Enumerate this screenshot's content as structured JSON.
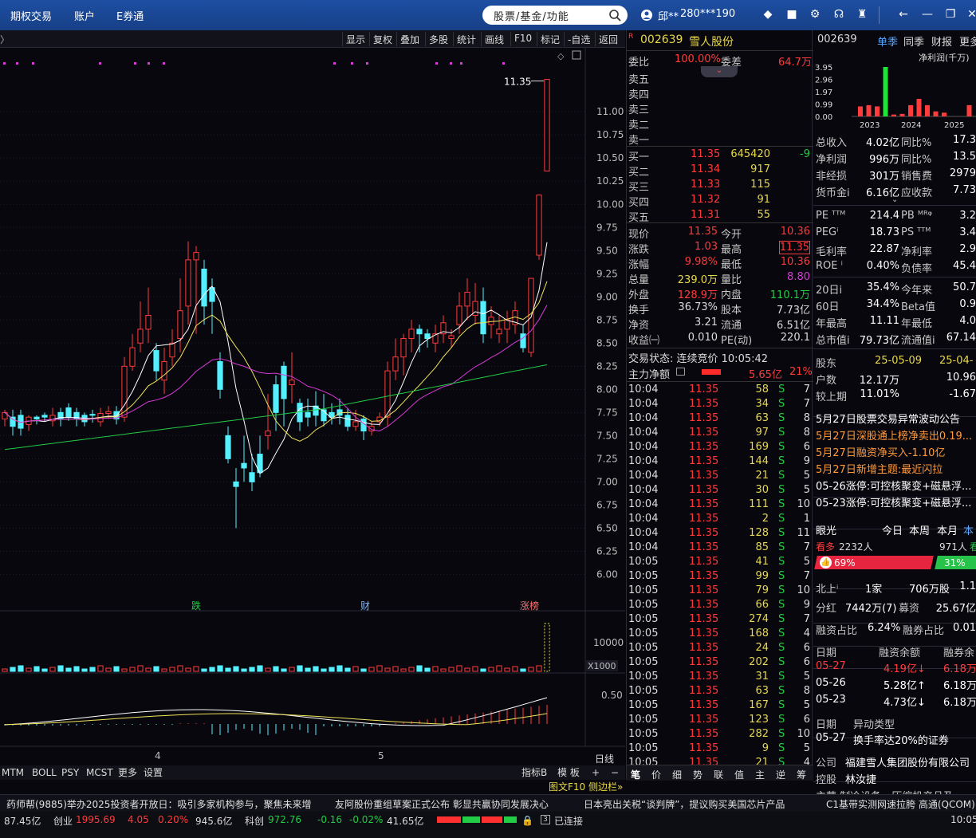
{
  "topbar": {
    "menus": [
      "期权交易",
      "账户",
      "E券通"
    ],
    "search_placeholder": "股票/基金/功能",
    "user_name": "邱**",
    "user_phone": "280***190"
  },
  "chart_toolbar": {
    "buttons": [
      "显示",
      "复权",
      "叠加",
      "多股",
      "统计",
      "画线",
      "F10",
      "标记",
      "-自选",
      "返回"
    ]
  },
  "chart": {
    "last_price_label": "11.35",
    "y_ticks": [
      "11.00",
      "10.75",
      "10.50",
      "10.25",
      "10.00",
      "9.75",
      "9.50",
      "9.25",
      "9.00",
      "8.75",
      "8.50",
      "8.25",
      "8.00",
      "7.75",
      "7.50",
      "7.25",
      "7.00",
      "6.75",
      "6.50",
      "6.25",
      "6.00"
    ],
    "markers": [
      {
        "text": "跌",
        "color": "#22cc44"
      },
      {
        "text": "财",
        "color": "#7fb8ff"
      },
      {
        "text": "涨榜",
        "color": "#ff7070"
      }
    ],
    "vol_tick": "10000",
    "vol_scale": "X1000",
    "macd_tick": "0.50",
    "months": [
      "4",
      "5"
    ],
    "period": "日线",
    "bottom_tabs": [
      "MTM",
      "BOLL",
      "PSY",
      "MCST",
      "更多",
      "设置"
    ],
    "right_tabs": [
      "指标B",
      "模 板",
      "+",
      "−"
    ]
  },
  "chart_data": {
    "type": "candlestick",
    "ylim": [
      5.9,
      11.45
    ],
    "candles": [
      [
        7.68,
        7.75,
        7.6,
        7.78
      ],
      [
        7.7,
        7.6,
        7.5,
        7.78
      ],
      [
        7.72,
        7.58,
        7.5,
        7.78
      ],
      [
        7.62,
        7.7,
        7.55,
        7.72
      ],
      [
        7.7,
        7.68,
        7.62,
        7.72
      ],
      [
        7.72,
        7.7,
        7.65,
        7.75
      ],
      [
        7.66,
        7.72,
        7.6,
        7.8
      ],
      [
        7.75,
        7.68,
        7.6,
        7.8
      ],
      [
        7.8,
        7.7,
        7.66,
        7.85
      ],
      [
        7.75,
        7.68,
        7.6,
        7.8
      ],
      [
        7.72,
        7.65,
        7.6,
        7.75
      ],
      [
        7.73,
        7.72,
        7.64,
        7.78
      ],
      [
        7.65,
        7.74,
        7.6,
        7.8
      ],
      [
        7.74,
        7.76,
        7.68,
        7.82
      ],
      [
        7.76,
        7.68,
        7.62,
        7.82
      ],
      [
        7.7,
        8.25,
        7.65,
        8.35
      ],
      [
        8.25,
        8.45,
        8.2,
        8.6
      ],
      [
        8.5,
        8.65,
        8.4,
        8.95
      ],
      [
        8.65,
        8.8,
        8.5,
        9.1
      ],
      [
        8.42,
        8.2,
        8.1,
        8.5
      ],
      [
        8.1,
        8.3,
        7.95,
        8.45
      ],
      [
        8.35,
        8.5,
        8.25,
        8.65
      ],
      [
        8.55,
        8.85,
        8.4,
        9.2
      ],
      [
        8.9,
        9.4,
        8.7,
        9.6
      ],
      [
        9.4,
        9.48,
        8.6,
        9.55
      ],
      [
        9.3,
        8.9,
        8.7,
        9.4
      ],
      [
        9.1,
        8.95,
        8.6,
        9.2
      ],
      [
        8.3,
        8.0,
        7.9,
        8.4
      ],
      [
        7.5,
        7.25,
        7.2,
        7.6
      ],
      [
        7.0,
        6.95,
        6.5,
        7.15
      ],
      [
        7.2,
        7.15,
        7.0,
        7.5
      ],
      [
        7.1,
        7.0,
        6.9,
        7.3
      ],
      [
        7.3,
        7.1,
        7.05,
        7.5
      ],
      [
        7.5,
        7.55,
        7.35,
        7.95
      ],
      [
        8.05,
        7.75,
        7.55,
        8.15
      ],
      [
        8.25,
        7.9,
        7.6,
        8.3
      ],
      [
        8.05,
        8.1,
        7.85,
        8.4
      ],
      [
        7.85,
        7.65,
        7.55,
        7.9
      ],
      [
        7.75,
        7.7,
        7.6,
        7.9
      ],
      [
        7.82,
        7.72,
        7.6,
        7.98
      ],
      [
        7.78,
        7.66,
        7.6,
        7.95
      ],
      [
        7.75,
        7.7,
        7.62,
        7.85
      ],
      [
        7.78,
        7.72,
        7.62,
        7.9
      ],
      [
        7.72,
        7.6,
        7.55,
        7.8
      ],
      [
        7.6,
        7.65,
        7.55,
        7.78
      ],
      [
        7.68,
        7.55,
        7.45,
        7.72
      ],
      [
        7.55,
        7.6,
        7.5,
        7.65
      ],
      [
        7.65,
        7.7,
        7.6,
        7.75
      ],
      [
        7.7,
        8.2,
        7.6,
        8.3
      ],
      [
        8.2,
        8.35,
        8.1,
        8.55
      ],
      [
        8.35,
        8.55,
        8.15,
        8.6
      ],
      [
        8.55,
        8.65,
        8.4,
        8.75
      ],
      [
        8.65,
        8.6,
        8.4,
        8.7
      ],
      [
        8.6,
        8.55,
        8.45,
        8.65
      ],
      [
        8.5,
        8.6,
        8.4,
        8.7
      ],
      [
        8.6,
        8.72,
        8.5,
        8.8
      ],
      [
        8.55,
        8.58,
        8.45,
        8.65
      ],
      [
        8.7,
        8.9,
        8.6,
        9.05
      ],
      [
        8.9,
        9.05,
        8.75,
        9.2
      ],
      [
        8.8,
        8.95,
        8.7,
        9.15
      ],
      [
        8.95,
        8.6,
        8.5,
        9.1
      ],
      [
        8.7,
        8.78,
        8.55,
        8.9
      ],
      [
        8.6,
        8.65,
        8.5,
        8.8
      ],
      [
        8.65,
        8.75,
        8.5,
        8.85
      ],
      [
        8.7,
        8.85,
        8.6,
        8.95
      ],
      [
        8.6,
        8.45,
        8.4,
        8.7
      ],
      [
        8.4,
        9.2,
        8.35,
        9.2
      ],
      [
        9.45,
        10.1,
        9.4,
        10.1
      ],
      [
        10.36,
        11.35,
        10.36,
        11.35
      ]
    ]
  },
  "quote": {
    "code": "002639",
    "name": "雪人股份",
    "wb_label": "委比",
    "wb": "100.00%",
    "wc_label": "委差",
    "wc": "64.7万",
    "sells": [
      "卖五",
      "卖四",
      "卖三",
      "卖二",
      "卖一"
    ],
    "buys": [
      {
        "l": "买一",
        "p": "11.35",
        "v": "645420",
        "c": "-9"
      },
      {
        "l": "买二",
        "p": "11.34",
        "v": "917",
        "c": ""
      },
      {
        "l": "买三",
        "p": "11.33",
        "v": "115",
        "c": ""
      },
      {
        "l": "买四",
        "p": "11.32",
        "v": "91",
        "c": ""
      },
      {
        "l": "买五",
        "p": "11.31",
        "v": "55",
        "c": ""
      }
    ],
    "stats": [
      [
        "现价",
        "11.35",
        "r",
        "今开",
        "10.36",
        "r"
      ],
      [
        "涨跌",
        "1.03",
        "r",
        "最高",
        "11.35",
        "r"
      ],
      [
        "涨幅",
        "9.98%",
        "r",
        "最低",
        "10.36",
        "r"
      ],
      [
        "总量",
        "239.0万",
        "y",
        "量比",
        "8.80",
        "p"
      ],
      [
        "外盘",
        "128.9万",
        "r",
        "内盘",
        "110.1万",
        "g"
      ],
      [
        "换手",
        "36.73%",
        "w",
        "股本",
        "7.73亿",
        "w"
      ],
      [
        "净资",
        "3.21",
        "w",
        "流通",
        "6.51亿",
        "w"
      ],
      [
        "收益㈠",
        "0.010",
        "w",
        "PE(动)",
        "220.1",
        "w"
      ]
    ],
    "trade_status": "交易状态: 连续竞价 10:05:42",
    "main_flow_label": "主力净额",
    "main_flow": "5.65亿",
    "main_flow_pct": "21%"
  },
  "ticks": [
    [
      "10:04",
      "11.35",
      "58",
      "S",
      "7"
    ],
    [
      "10:04",
      "11.35",
      "34",
      "S",
      "7"
    ],
    [
      "10:04",
      "11.35",
      "63",
      "S",
      "8"
    ],
    [
      "10:04",
      "11.35",
      "97",
      "S",
      "8"
    ],
    [
      "10:04",
      "11.35",
      "169",
      "S",
      "6"
    ],
    [
      "10:04",
      "11.35",
      "144",
      "S",
      "9"
    ],
    [
      "10:04",
      "11.35",
      "21",
      "S",
      "5"
    ],
    [
      "10:04",
      "11.35",
      "30",
      "S",
      "5"
    ],
    [
      "10:04",
      "11.35",
      "111",
      "S",
      "10"
    ],
    [
      "10:04",
      "11.35",
      "2",
      "S",
      "1"
    ],
    [
      "10:04",
      "11.35",
      "128",
      "S",
      "11"
    ],
    [
      "10:04",
      "11.35",
      "85",
      "S",
      "7"
    ],
    [
      "10:05",
      "11.35",
      "41",
      "S",
      "5"
    ],
    [
      "10:05",
      "11.35",
      "99",
      "S",
      "7"
    ],
    [
      "10:05",
      "11.35",
      "79",
      "S",
      "10"
    ],
    [
      "10:05",
      "11.35",
      "66",
      "S",
      "9"
    ],
    [
      "10:05",
      "11.35",
      "274",
      "S",
      "7"
    ],
    [
      "10:05",
      "11.35",
      "168",
      "S",
      "4"
    ],
    [
      "10:05",
      "11.35",
      "24",
      "S",
      "6"
    ],
    [
      "10:05",
      "11.35",
      "202",
      "S",
      "6"
    ],
    [
      "10:05",
      "11.35",
      "31",
      "S",
      "5"
    ],
    [
      "10:05",
      "11.35",
      "63",
      "S",
      "8"
    ],
    [
      "10:05",
      "11.35",
      "167",
      "S",
      "5"
    ],
    [
      "10:05",
      "11.35",
      "123",
      "S",
      "6"
    ],
    [
      "10:05",
      "11.35",
      "282",
      "S",
      "10"
    ],
    [
      "10:05",
      "11.35",
      "9",
      "S",
      "5"
    ],
    [
      "10:05",
      "11.35",
      "21",
      "S",
      "4"
    ]
  ],
  "quote_tabs": [
    "笔",
    "价",
    "细",
    "势",
    "联",
    "值",
    "主",
    "逆",
    "筹"
  ],
  "f10": {
    "code": "002639",
    "tabs": [
      "单季",
      "同季",
      "财报",
      "更多"
    ],
    "fin_label": "净利润(千万)",
    "bar_ticks": [
      "3.95",
      "2.96",
      "1.97",
      "0.99",
      "0.00"
    ],
    "years": [
      "2023",
      "2024",
      "2025"
    ],
    "fin_values": [
      0.8,
      0.9,
      0.8,
      3.95,
      0.15,
      0.2,
      0.9,
      1.4,
      0.9,
      0.4,
      0.3,
      0.0,
      0.0,
      0.9
    ],
    "rows1": [
      [
        "总收入",
        "4.02亿",
        "同比%",
        "17.3"
      ],
      [
        "净利润",
        "996万",
        "同比%",
        "13.5"
      ],
      [
        "非经损",
        "301万",
        "销售费",
        "2979"
      ],
      [
        "货币金i",
        "6.16亿",
        "应收款",
        "7.73"
      ]
    ],
    "rows2": [
      [
        "PE ᵀᵀᴹ",
        "214.4",
        "PB ᴹᴿᵠ",
        "3.2"
      ],
      [
        "PEGⁱ",
        "18.73",
        "PS ᵀᵀᴹ",
        "3.4"
      ],
      [
        "毛利率",
        "22.87",
        "净利率",
        "2.9"
      ],
      [
        "ROE ⁱ",
        "0.40%",
        "负债率",
        "45.4"
      ]
    ],
    "rows3": [
      [
        "20日i",
        "35.4%",
        "今年来",
        "50.7"
      ],
      [
        "60日",
        "34.4%",
        "Beta值",
        "0.9"
      ],
      [
        "年最高",
        "11.11",
        "年最低",
        "4.0"
      ],
      [
        "总市值i",
        "79.73亿",
        "流通值i",
        "67.14"
      ]
    ],
    "holders": {
      "label": "股东",
      "d1": "25-05-09",
      "d2": "25-04-",
      "hu_label": "户数",
      "hu1": "12.17万",
      "hu2": "10.96",
      "jsq_label": "较上期",
      "jsq1": "11.01%",
      "jsq2": "-1.67"
    },
    "news": [
      "5月27日股票交易异常波动公告",
      "5月27日深股通上榜净卖出0.19...",
      "5月27日融资净买入-1.10亿",
      "5月27日新增主题:最近闪拉"
    ],
    "news2": [
      "05-26涨停:可控核聚变+磁悬浮...",
      "05-23涨停:可控核聚变+磁悬浮..."
    ],
    "yanguang": {
      "label": "眼光",
      "tabs": [
        "今日",
        "本周",
        "本月",
        "本"
      ],
      "kd": "看多",
      "kd_n": "2232人",
      "kk_n": "971人",
      "kk": "看",
      "bull_pct": "69%",
      "bear_pct": "31%",
      "bull_frac": 0.69
    },
    "north": [
      "北上ⁱ",
      "1家",
      "706万股",
      "1.1"
    ],
    "fenhong": [
      "分红",
      "7442万(7)",
      "募资",
      "25.67亿"
    ],
    "rzzb": [
      "融资占比",
      "6.24%",
      "融券占比",
      "0.01"
    ],
    "margin_head": [
      "日期",
      "融资余额",
      "融券余"
    ],
    "margin": [
      [
        "05-27",
        "4.19亿↓",
        "6.18万"
      ],
      [
        "05-26",
        "5.28亿↑",
        "6.18万"
      ],
      [
        "05-23",
        "4.73亿↓",
        "6.18万"
      ]
    ],
    "abnormal_head": [
      "日期",
      "异动类型"
    ],
    "abnormal": [
      "05-27",
      "换手率达20%的证券"
    ],
    "company": [
      "公司",
      "福建雪人集团股份有限公司"
    ],
    "controller": [
      "控股",
      "林汝捷"
    ],
    "business": "主营 制冷设备、压缩机产品及..."
  },
  "ticker": {
    "items": [
      "药师帮(9885)举办2025投资者开放日：吸引多家机构参与，聚焦未来增",
      "友阿股份重组草案正式公布 彰显共赢协同发展决心",
      "日本亮出关税“谈判牌”，提议购买美国芯片产品",
      "C1基带实测网速拉胯 高通(QCOM)"
    ],
    "side": "图文F10 侧边栏»"
  },
  "status": {
    "a": "87.45亿",
    "cy_label": "创业",
    "cy": "1995.69",
    "cy_chg": "4.05",
    "cy_pct": "0.20%",
    "cy_amt": "945.6亿",
    "kc_label": "科创",
    "kc": "972.76",
    "kc_chg": "-0.16",
    "kc_pct": "-0.02%",
    "kc_amt": "41.65亿",
    "conn": "已连接",
    "time": "10:05"
  }
}
